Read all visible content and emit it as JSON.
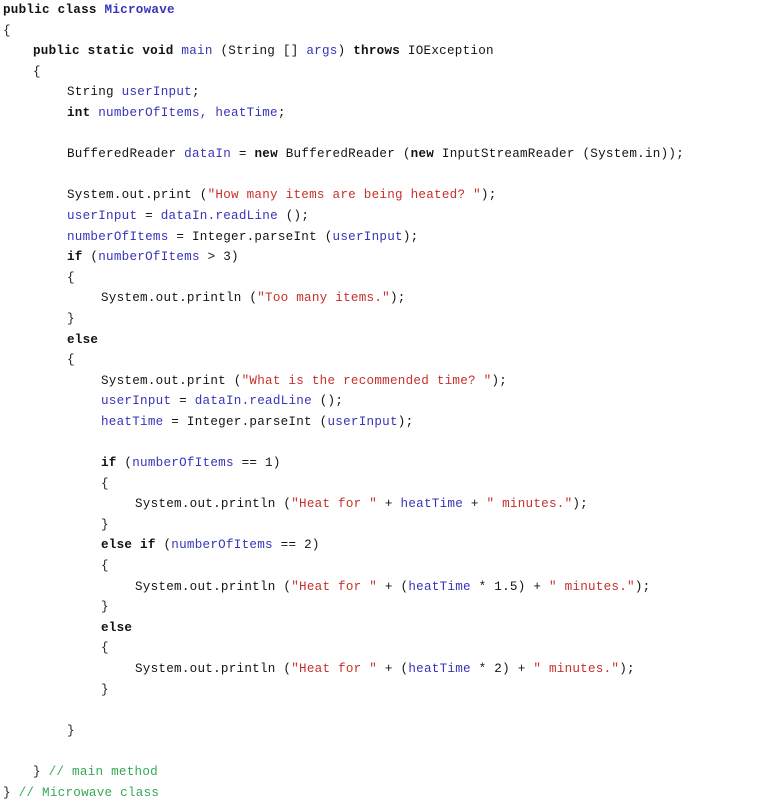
{
  "document": {
    "kind": "java-source-listing",
    "class_name": "Microwave",
    "method_name": "main",
    "colors": {
      "text": "#141414",
      "keyword": "#111111",
      "identifier": "#3734b9",
      "string": "#c6302c",
      "comment": "#35a854",
      "background": "#ffffff"
    }
  },
  "lines": [
    {
      "indent": 0,
      "tokens": [
        {
          "t": "keyword",
          "s": "public class "
        },
        {
          "t": "identb",
          "s": "Microwave"
        }
      ]
    },
    {
      "indent": 0,
      "tokens": [
        {
          "t": "brace",
          "s": "{"
        }
      ]
    },
    {
      "indent": 1,
      "tokens": [
        {
          "t": "keyword",
          "s": "public static void "
        },
        {
          "t": "ident",
          "s": "main"
        },
        {
          "t": "plain",
          "s": " (String [] "
        },
        {
          "t": "ident",
          "s": "args"
        },
        {
          "t": "plain",
          "s": ") "
        },
        {
          "t": "keyword",
          "s": "throws"
        },
        {
          "t": "plain",
          "s": " IOException"
        }
      ]
    },
    {
      "indent": 1,
      "tokens": [
        {
          "t": "brace",
          "s": "{"
        }
      ]
    },
    {
      "indent": 2,
      "tokens": [
        {
          "t": "plain",
          "s": "String "
        },
        {
          "t": "ident",
          "s": "userInput"
        },
        {
          "t": "plain",
          "s": ";"
        }
      ]
    },
    {
      "indent": 2,
      "tokens": [
        {
          "t": "keyword",
          "s": "int "
        },
        {
          "t": "ident",
          "s": "numberOfItems, heatTime"
        },
        {
          "t": "plain",
          "s": ";"
        }
      ]
    },
    {
      "indent": 0,
      "tokens": []
    },
    {
      "indent": 2,
      "tokens": [
        {
          "t": "plain",
          "s": "BufferedReader "
        },
        {
          "t": "ident",
          "s": "dataIn"
        },
        {
          "t": "plain",
          "s": " = "
        },
        {
          "t": "keyword",
          "s": "new"
        },
        {
          "t": "plain",
          "s": " BufferedReader ("
        },
        {
          "t": "keyword",
          "s": "new"
        },
        {
          "t": "plain",
          "s": " InputStreamReader (System.in));"
        }
      ]
    },
    {
      "indent": 0,
      "tokens": []
    },
    {
      "indent": 2,
      "tokens": [
        {
          "t": "plain",
          "s": "System.out.print ("
        },
        {
          "t": "string",
          "s": "\"How many items are being heated? \""
        },
        {
          "t": "plain",
          "s": ");"
        }
      ]
    },
    {
      "indent": 2,
      "tokens": [
        {
          "t": "ident",
          "s": "userInput"
        },
        {
          "t": "plain",
          "s": " = "
        },
        {
          "t": "ident",
          "s": "dataIn.readLine"
        },
        {
          "t": "plain",
          "s": " ();"
        }
      ]
    },
    {
      "indent": 2,
      "tokens": [
        {
          "t": "ident",
          "s": "numberOfItems"
        },
        {
          "t": "plain",
          "s": " = Integer.parseInt ("
        },
        {
          "t": "ident",
          "s": "userInput"
        },
        {
          "t": "plain",
          "s": ");"
        }
      ]
    },
    {
      "indent": 2,
      "tokens": [
        {
          "t": "keyword",
          "s": "if"
        },
        {
          "t": "plain",
          "s": " ("
        },
        {
          "t": "ident",
          "s": "numberOfItems"
        },
        {
          "t": "plain",
          "s": " > 3)"
        }
      ]
    },
    {
      "indent": 2,
      "tokens": [
        {
          "t": "brace",
          "s": "{"
        }
      ]
    },
    {
      "indent": 3,
      "tokens": [
        {
          "t": "plain",
          "s": "System.out.println ("
        },
        {
          "t": "string",
          "s": "\"Too many items.\""
        },
        {
          "t": "plain",
          "s": ");"
        }
      ]
    },
    {
      "indent": 2,
      "tokens": [
        {
          "t": "brace",
          "s": "}"
        }
      ]
    },
    {
      "indent": 2,
      "tokens": [
        {
          "t": "keyword",
          "s": "else"
        }
      ]
    },
    {
      "indent": 2,
      "tokens": [
        {
          "t": "brace",
          "s": "{"
        }
      ]
    },
    {
      "indent": 3,
      "tokens": [
        {
          "t": "plain",
          "s": "System.out.print ("
        },
        {
          "t": "string",
          "s": "\"What is the recommended time? \""
        },
        {
          "t": "plain",
          "s": ");"
        }
      ]
    },
    {
      "indent": 3,
      "tokens": [
        {
          "t": "ident",
          "s": "userInput"
        },
        {
          "t": "plain",
          "s": " = "
        },
        {
          "t": "ident",
          "s": "dataIn.readLine"
        },
        {
          "t": "plain",
          "s": " ();"
        }
      ]
    },
    {
      "indent": 3,
      "tokens": [
        {
          "t": "ident",
          "s": "heatTime"
        },
        {
          "t": "plain",
          "s": " = Integer.parseInt ("
        },
        {
          "t": "ident",
          "s": "userInput"
        },
        {
          "t": "plain",
          "s": ");"
        }
      ]
    },
    {
      "indent": 0,
      "tokens": []
    },
    {
      "indent": 3,
      "tokens": [
        {
          "t": "keyword",
          "s": "if"
        },
        {
          "t": "plain",
          "s": " ("
        },
        {
          "t": "ident",
          "s": "numberOfItems"
        },
        {
          "t": "plain",
          "s": " == 1)"
        }
      ]
    },
    {
      "indent": 3,
      "tokens": [
        {
          "t": "brace",
          "s": "{"
        }
      ]
    },
    {
      "indent": 4,
      "tokens": [
        {
          "t": "plain",
          "s": "System.out.println ("
        },
        {
          "t": "string",
          "s": "\"Heat for \""
        },
        {
          "t": "plain",
          "s": " + "
        },
        {
          "t": "ident",
          "s": "heatTime"
        },
        {
          "t": "plain",
          "s": " + "
        },
        {
          "t": "string",
          "s": "\" minutes.\""
        },
        {
          "t": "plain",
          "s": ");"
        }
      ]
    },
    {
      "indent": 3,
      "tokens": [
        {
          "t": "brace",
          "s": "}"
        }
      ]
    },
    {
      "indent": 3,
      "tokens": [
        {
          "t": "keyword",
          "s": "else if"
        },
        {
          "t": "plain",
          "s": " ("
        },
        {
          "t": "ident",
          "s": "numberOfItems"
        },
        {
          "t": "plain",
          "s": " == 2)"
        }
      ]
    },
    {
      "indent": 3,
      "tokens": [
        {
          "t": "brace",
          "s": "{"
        }
      ]
    },
    {
      "indent": 4,
      "tokens": [
        {
          "t": "plain",
          "s": "System.out.println ("
        },
        {
          "t": "string",
          "s": "\"Heat for \""
        },
        {
          "t": "plain",
          "s": " + ("
        },
        {
          "t": "ident",
          "s": "heatTime"
        },
        {
          "t": "plain",
          "s": " * 1.5) + "
        },
        {
          "t": "string",
          "s": "\" minutes.\""
        },
        {
          "t": "plain",
          "s": ");"
        }
      ]
    },
    {
      "indent": 3,
      "tokens": [
        {
          "t": "brace",
          "s": "}"
        }
      ]
    },
    {
      "indent": 3,
      "tokens": [
        {
          "t": "keyword",
          "s": "else"
        }
      ]
    },
    {
      "indent": 3,
      "tokens": [
        {
          "t": "brace",
          "s": "{"
        }
      ]
    },
    {
      "indent": 4,
      "tokens": [
        {
          "t": "plain",
          "s": "System.out.println ("
        },
        {
          "t": "string",
          "s": "\"Heat for \""
        },
        {
          "t": "plain",
          "s": " + ("
        },
        {
          "t": "ident",
          "s": "heatTime"
        },
        {
          "t": "plain",
          "s": " * 2) + "
        },
        {
          "t": "string",
          "s": "\" minutes.\""
        },
        {
          "t": "plain",
          "s": ");"
        }
      ]
    },
    {
      "indent": 3,
      "tokens": [
        {
          "t": "brace",
          "s": "}"
        }
      ]
    },
    {
      "indent": 0,
      "tokens": []
    },
    {
      "indent": 2,
      "tokens": [
        {
          "t": "brace",
          "s": "}"
        }
      ]
    },
    {
      "indent": 0,
      "tokens": []
    },
    {
      "indent": 1,
      "tokens": [
        {
          "t": "brace",
          "s": "} "
        },
        {
          "t": "comment",
          "s": "// main method"
        }
      ]
    },
    {
      "indent": 0,
      "tokens": [
        {
          "t": "brace",
          "s": "} "
        },
        {
          "t": "comment",
          "s": "// Microwave class"
        }
      ]
    }
  ]
}
